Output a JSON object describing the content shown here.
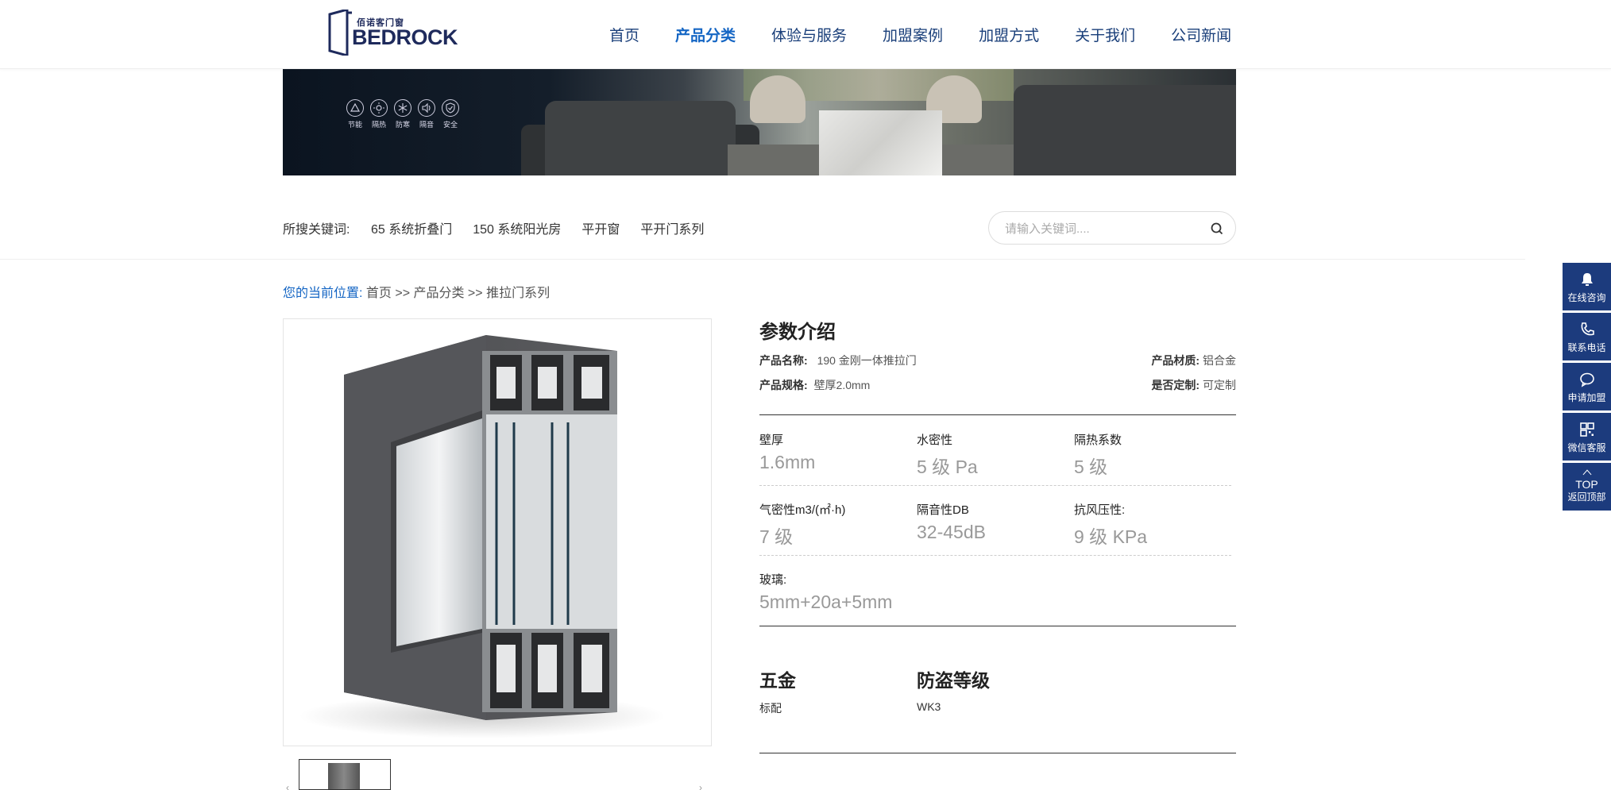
{
  "header": {
    "logo_sub": "佰诺客门窗",
    "logo_main": "BEDROCK",
    "nav": [
      "首页",
      "产品分类",
      "体验与服务",
      "加盟案例",
      "加盟方式",
      "关于我们",
      "公司新闻"
    ],
    "active_nav": "产品分类"
  },
  "banner": {
    "features": [
      "节能",
      "隔热",
      "防寒",
      "隔音",
      "安全"
    ]
  },
  "keywords": {
    "label": "所搜关键词:",
    "items": [
      "65 系统折叠门",
      "150 系统阳光房",
      "平开窗",
      "平开门系列"
    ],
    "search_placeholder": "请输入关键词....",
    "search_icon": "search-icon"
  },
  "breadcrumb": {
    "lead": "您的当前位置:",
    "path": "首页 >> 产品分类 >> 推拉门系列"
  },
  "params": {
    "title": "参数介绍",
    "name_key": "产品名称:",
    "name_val": "190 金刚一体推拉门",
    "material_key": "产品材质:",
    "material_val": "铝合金",
    "spec_key": "产品规格:",
    "spec_val": "壁厚2.0mm",
    "custom_key": "是否定制:",
    "custom_val": "可定制",
    "specs": [
      {
        "k": "壁厚",
        "v": "1.6mm"
      },
      {
        "k": "水密性",
        "v": "5 级 Pa"
      },
      {
        "k": "隔热系数",
        "v": "5 级"
      },
      {
        "k": "气密性m3/(㎡·h)",
        "v": "7 级"
      },
      {
        "k": "隔音性DB",
        "v": "32-45dB"
      },
      {
        "k": "抗风压性:",
        "v": "9 级 KPa"
      },
      {
        "k": "玻璃:",
        "v": "5mm+20a+5mm"
      }
    ],
    "hardware_key": "五金",
    "hardware_val": "标配",
    "security_key": "防盗等级",
    "security_val": "WK3"
  },
  "sidebar": {
    "items": [
      "在线咨询",
      "联系电话",
      "申请加盟",
      "微信客服",
      "返回顶部"
    ],
    "top_label": "TOP"
  },
  "colors": {
    "brand": "#1c3b7d",
    "link": "#1566c4",
    "nav": "#1a3f7a"
  }
}
